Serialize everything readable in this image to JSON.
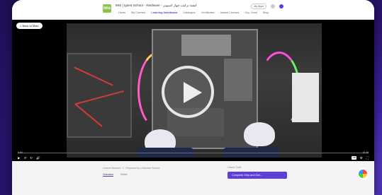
{
  "header": {
    "logo_text": "ims",
    "course_title": "IMS | Igned School - Hardware - كيفية تركيب جهاز كمبيوتر",
    "nav": [
      "Home",
      "My Courses",
      "Learning Dashboard",
      "Catalogue",
      "Certificates",
      "Instant Courses",
      "Org. Chart",
      "Blog"
    ],
    "active_nav_index": 2,
    "my_apps": "My Apps"
  },
  "video": {
    "back_label": "< Back to Main",
    "time_current": "0:03",
    "time_total": "12:16",
    "progress": 0.01,
    "hd_label": "HD"
  },
  "below": {
    "lesson_meta": "Lesson Number: 1 · Prepared by Unknown Source",
    "tabs": [
      "Overview",
      "Notes"
    ],
    "active_tab_index": 0,
    "sidebar_label": "Lesson Tools",
    "complete_button": "Complete Step and Get..."
  },
  "colors": {
    "accent": "#5b3fd6",
    "background": "#2a1470"
  }
}
